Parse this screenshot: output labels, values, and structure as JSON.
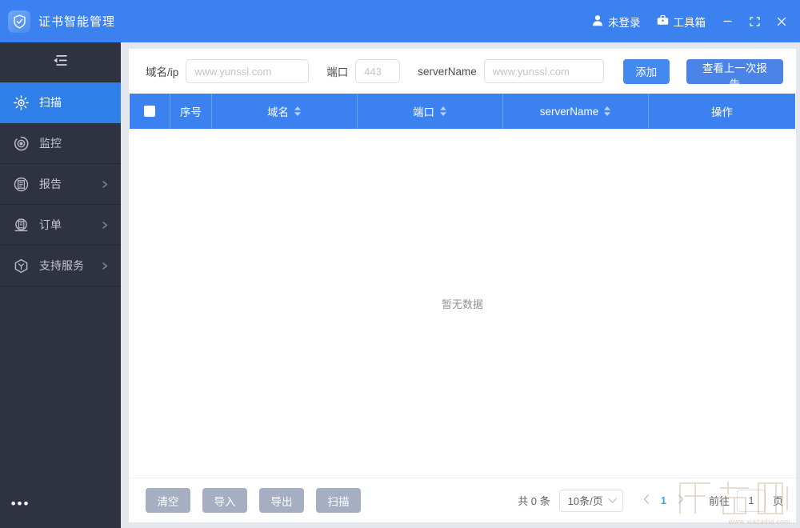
{
  "titlebar": {
    "app_icon": "shield-check-icon",
    "title": "证书智能管理",
    "user_icon": "user-icon",
    "user_label": "未登录",
    "toolbox_icon": "toolbox-icon",
    "toolbox_label": "工具箱",
    "minimize": "minimize-icon",
    "maximize": "maximize-icon",
    "close": "close-icon",
    "bg_color": "#3b82f0"
  },
  "sidebar": {
    "collapse_icon": "collapse-menu-icon",
    "bg_color": "#2f3341",
    "active_color": "#2f7fe8",
    "items": [
      {
        "label": "扫描",
        "icon": "scan-icon",
        "active": true,
        "arrow": false
      },
      {
        "label": "监控",
        "icon": "monitor-icon",
        "active": false,
        "arrow": false
      },
      {
        "label": "报告",
        "icon": "report-icon",
        "active": false,
        "arrow": true
      },
      {
        "label": "订单",
        "icon": "order-icon",
        "active": false,
        "arrow": true
      },
      {
        "label": "支持服务",
        "icon": "support-icon",
        "active": false,
        "arrow": true
      }
    ],
    "more_label": "•••"
  },
  "form": {
    "domain_label": "域名/ip",
    "domain_value": "",
    "domain_placeholder": "www.yunssl.com",
    "port_label": "端口",
    "port_value": "",
    "port_placeholder": "443",
    "server_label": "serverName",
    "server_value": "",
    "server_placeholder": "www.yunssl.com",
    "add_label": "添加",
    "report_label": "查看上一次报告"
  },
  "table": {
    "header_bg": "#3b82f0",
    "columns": [
      {
        "key": "check",
        "label": "",
        "sortable": false
      },
      {
        "key": "no",
        "label": "序号",
        "sortable": false
      },
      {
        "key": "domain",
        "label": "域名",
        "sortable": true
      },
      {
        "key": "port",
        "label": "端口",
        "sortable": true
      },
      {
        "key": "server",
        "label": "serverName",
        "sortable": true
      },
      {
        "key": "op",
        "label": "操作",
        "sortable": false
      }
    ],
    "rows": [],
    "empty_text": "暂无数据"
  },
  "footer": {
    "buttons": [
      {
        "label": "清空",
        "name": "clear-button"
      },
      {
        "label": "导入",
        "name": "import-button"
      },
      {
        "label": "导出",
        "name": "export-button"
      },
      {
        "label": "扫描",
        "name": "scan-button"
      }
    ],
    "pagination": {
      "total_text": "共 0 条",
      "page_size_label": "10条/页",
      "prev_icon": "chevron-left-icon",
      "next_icon": "chevron-right-icon",
      "current_page": "1",
      "jump_prefix": "前往",
      "jump_value": "1",
      "jump_suffix": "页",
      "active_color": "#409eff"
    }
  },
  "watermark": {
    "logo_text": "下载吧",
    "url_text": "www.xiazaiba.com"
  }
}
